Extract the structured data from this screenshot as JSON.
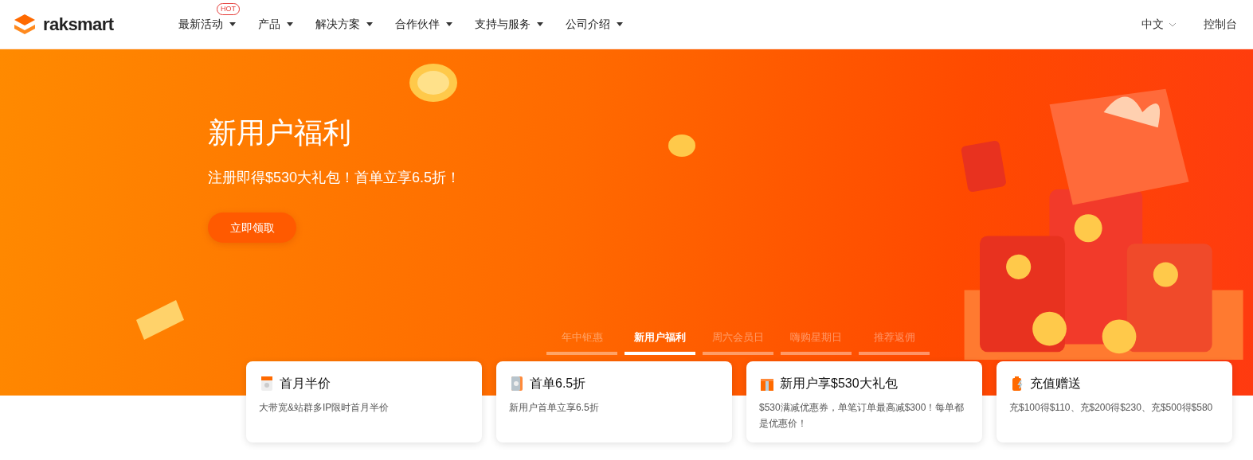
{
  "header": {
    "logo": "raksmart",
    "nav": [
      {
        "label": "最新活动",
        "badge": "HOT"
      },
      {
        "label": "产品"
      },
      {
        "label": "解决方案"
      },
      {
        "label": "合作伙伴"
      },
      {
        "label": "支持与服务"
      },
      {
        "label": "公司介绍"
      }
    ],
    "language": "中文",
    "console": "控制台"
  },
  "hero": {
    "title": "新用户福利",
    "subtitle": "注册即得$530大礼包！首单立享6.5折！",
    "button": "立即领取"
  },
  "tabs": [
    {
      "label": "年中钜惠",
      "selected": false
    },
    {
      "label": "新用户福利",
      "selected": true
    },
    {
      "label": "周六会员日",
      "selected": false
    },
    {
      "label": "嗨购星期日",
      "selected": false
    },
    {
      "label": "推荐返佣",
      "selected": false
    }
  ],
  "cards": [
    {
      "kind": "calendar",
      "title": "首月半价",
      "text": "大带宽&站群多IP限时首月半价"
    },
    {
      "kind": "coupon",
      "title": "首单6.5折",
      "text": "新用户首单立享6.5折"
    },
    {
      "kind": "gift",
      "title": "新用户享$530大礼包",
      "text": "$530满减优惠券，单笔订单最高减$300！每单都是优惠价！"
    },
    {
      "kind": "battery",
      "title": "充值赠送",
      "text": "充$100得$110、充$200得$230、充$500得$580"
    }
  ]
}
